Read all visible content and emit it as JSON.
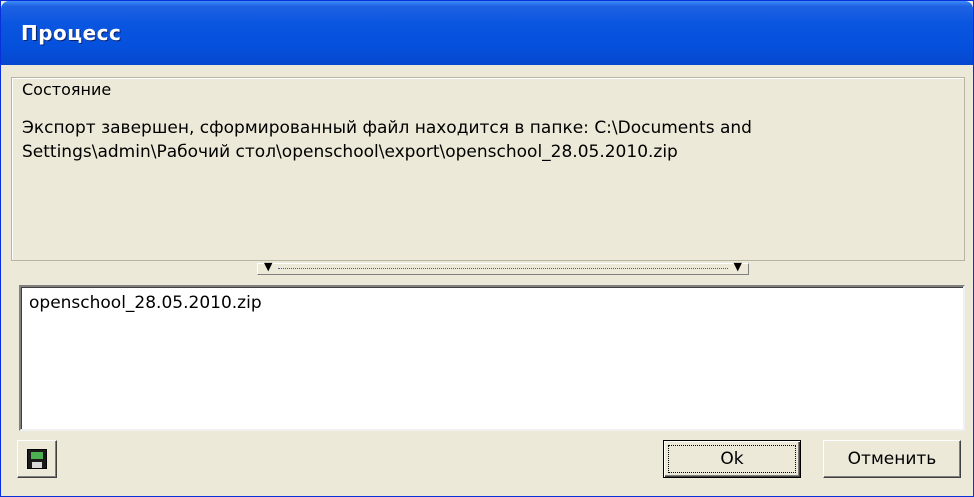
{
  "window": {
    "title": "Процесс"
  },
  "status_group": {
    "caption": "Состояние",
    "message": "Экспорт завершен, сформированный файл находится в папке: C:\\Documents and Settings\\admin\\Рабочий стол\\openschool\\export\\openschool_28.05.2010.zip"
  },
  "splitter": {
    "left_icon": "chevron-down-icon",
    "right_icon": "chevron-down-icon"
  },
  "file_list": {
    "items": [
      "openschool_28.05.2010.zip"
    ]
  },
  "buttons": {
    "save_icon": "floppy-disk-icon",
    "ok_label": "Ok",
    "cancel_label": "Отменить"
  }
}
